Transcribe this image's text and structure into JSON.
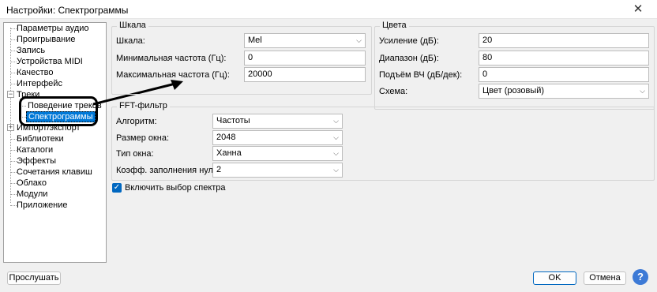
{
  "window": {
    "title": "Настройки: Спектрограммы",
    "close_glyph": "✕"
  },
  "tree": {
    "items": [
      {
        "label": "Параметры аудио"
      },
      {
        "label": "Проигрывание"
      },
      {
        "label": "Запись"
      },
      {
        "label": "Устройства MIDI"
      },
      {
        "label": "Качество"
      },
      {
        "label": "Интерфейс"
      },
      {
        "label": "Треки",
        "expander": "−"
      },
      {
        "label": "Поведение треков"
      },
      {
        "label": "Спектрограммы",
        "selected": true
      },
      {
        "label": "Импорт/экспорт",
        "expander": "+"
      },
      {
        "label": "Библиотеки"
      },
      {
        "label": "Каталоги"
      },
      {
        "label": "Эффекты"
      },
      {
        "label": "Сочетания клавиш"
      },
      {
        "label": "Облако"
      },
      {
        "label": "Модули"
      },
      {
        "label": "Приложение"
      }
    ]
  },
  "scale": {
    "title": "Шкала",
    "scale_label": "Шкала:",
    "scale_value": "Mel",
    "min_label": "Минимальная частота (Гц):",
    "min_value": "0",
    "max_label": "Максимальная частота (Гц):",
    "max_value": "20000"
  },
  "colors": {
    "title": "Цвета",
    "gain_label": "Усиление (дБ):",
    "gain_value": "20",
    "range_label": "Диапазон (дБ):",
    "range_value": "80",
    "hf_label": "Подъём ВЧ (дБ/дек):",
    "hf_value": "0",
    "scheme_label": "Схема:",
    "scheme_value": "Цвет (розовый)"
  },
  "fft": {
    "title": "FFT-фильтр",
    "algo_label": "Алгоритм:",
    "algo_value": "Частоты",
    "size_label": "Размер окна:",
    "size_value": "2048",
    "type_label": "Тип окна:",
    "type_value": "Ханна",
    "zero_label": "Коэфф. заполнения нулями:",
    "zero_value": "2"
  },
  "spectral_selection": {
    "label": "Включить выбор спектра",
    "checked": true
  },
  "buttons": {
    "preview": "Прослушать",
    "ok": "OK",
    "cancel": "Отмена",
    "help": "?"
  },
  "colors_ui": {
    "accent": "#0078d7",
    "arrow": "#000000"
  }
}
